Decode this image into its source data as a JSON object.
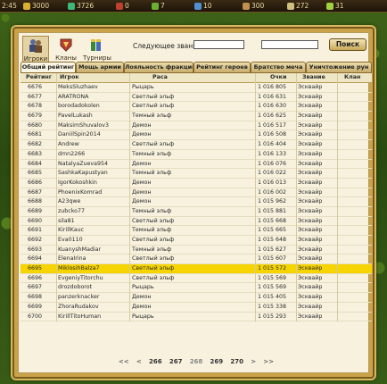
{
  "topbar": {
    "time": "2:45",
    "stats": [
      {
        "icon": "gold-coin-icon",
        "value": "3000",
        "color": "#d8b030"
      },
      {
        "icon": "gem-icon",
        "value": "3726",
        "color": "#3cb878"
      },
      {
        "icon": "potion-icon",
        "value": "0",
        "color": "#c04030"
      },
      {
        "icon": "herb-icon",
        "value": "7",
        "color": "#6ab030"
      },
      {
        "icon": "crystal-icon",
        "value": "10",
        "color": "#5090d0"
      },
      {
        "icon": "ore-icon",
        "value": "300",
        "color": "#c09050"
      },
      {
        "icon": "army-icon",
        "value": "272",
        "color": "#d0c080"
      },
      {
        "icon": "energy-icon",
        "value": "31",
        "color": "#a0d040"
      }
    ]
  },
  "nav": [
    {
      "label": "Игроки",
      "icon": "players-icon",
      "active": true
    },
    {
      "label": "Кланы",
      "icon": "clans-icon",
      "active": false
    },
    {
      "label": "Турниры",
      "icon": "tournaments-icon",
      "active": false
    }
  ],
  "search": {
    "next_title_label": "Следующее звание:",
    "next_title_value": "",
    "query_value": "",
    "find_label": "Поиск"
  },
  "tabs": [
    "Общий рейтинг",
    "Мощь армии",
    "Лояльность фракции",
    "Рейтинг героев",
    "Братство меча",
    "Уничтожение рун"
  ],
  "table": {
    "columns": [
      "Рейтинг",
      "Игрок",
      "Раса",
      "Очки",
      "Звание",
      "Клан"
    ],
    "rows": [
      [
        "6676",
        "MeksSluzhaev",
        "Рыцарь",
        "1 016 805",
        "Эсквайр",
        ""
      ],
      [
        "6677",
        "ARATRONA",
        "Светлый эльф",
        "1 016 631",
        "Эсквайр",
        ""
      ],
      [
        "6678",
        "borodadokolen",
        "Светлый эльф",
        "1 016 630",
        "Эсквайр",
        ""
      ],
      [
        "6679",
        "PavelLukash",
        "Темный эльф",
        "1 016 625",
        "Эсквайр",
        ""
      ],
      [
        "6680",
        "MaksimShuvalov3",
        "Демон",
        "1 016 517",
        "Эсквайр",
        ""
      ],
      [
        "6681",
        "DaniilSpin2014",
        "Демон",
        "1 016 508",
        "Эсквайр",
        ""
      ],
      [
        "6682",
        "Andrew",
        "Светлый эльф",
        "1 016 404",
        "Эсквайр",
        ""
      ],
      [
        "6683",
        "dmn2266",
        "Темный эльф",
        "1 016 133",
        "Эсквайр",
        ""
      ],
      [
        "6684",
        "NatalyaZueva954",
        "Демон",
        "1 016 076",
        "Эсквайр",
        ""
      ],
      [
        "6685",
        "SashkaKapustyan",
        "Темный эльф",
        "1 016 022",
        "Эсквайр",
        ""
      ],
      [
        "6686",
        "IgorKokoshkin",
        "Демон",
        "1 016 013",
        "Эсквайр",
        ""
      ],
      [
        "6687",
        "PhoenixKomrad",
        "Демон",
        "1 016 002",
        "Эсквайр",
        ""
      ],
      [
        "6688",
        "A23qwe",
        "Демон",
        "1 015 962",
        "Эсквайр",
        ""
      ],
      [
        "6689",
        "zubcko77",
        "Темный эльф",
        "1 015 881",
        "Эсквайр",
        ""
      ],
      [
        "6690",
        "sila81",
        "Светлый эльф",
        "1 015 668",
        "Эсквайр",
        ""
      ],
      [
        "6691",
        "KirillKauc",
        "Темный эльф",
        "1 015 665",
        "Эсквайр",
        ""
      ],
      [
        "6692",
        "Eva0110",
        "Светлый эльф",
        "1 015 648",
        "Эсквайр",
        ""
      ],
      [
        "6693",
        "KuanyshMadiar",
        "Темный эльф",
        "1 015 627",
        "Эсквайр",
        ""
      ],
      [
        "6694",
        "ElenaIrina",
        "Светлый эльф",
        "1 015 607",
        "Эсквайр",
        ""
      ],
      [
        "6695",
        "MiklosihBalza7",
        "Светлый эльф",
        "1 015 572",
        "Эсквайр",
        ""
      ],
      [
        "6696",
        "EvgeniyTitorchu",
        "Светлый эльф",
        "1 015 569",
        "Эсквайр",
        ""
      ],
      [
        "6697",
        "drozdoborot",
        "Рыцарь",
        "1 015 569",
        "Эсквайр",
        ""
      ],
      [
        "6698",
        "panzerknacker",
        "Демон",
        "1 015 405",
        "Эсквайр",
        ""
      ],
      [
        "6699",
        "ZhoraRudakov",
        "Демон",
        "1 015 338",
        "Эсквайр",
        ""
      ],
      [
        "6700",
        "KirillTitoHuman",
        "Рыцарь",
        "1 015 293",
        "Эсквайр",
        ""
      ]
    ],
    "highlight_rank": "6695",
    "highlight_color": "#f6d400"
  },
  "pager": {
    "first": "<<",
    "prev": "<",
    "pages": [
      "266",
      "267",
      "268",
      "269",
      "270"
    ],
    "current": "268",
    "next": ">",
    "last": ">>"
  }
}
